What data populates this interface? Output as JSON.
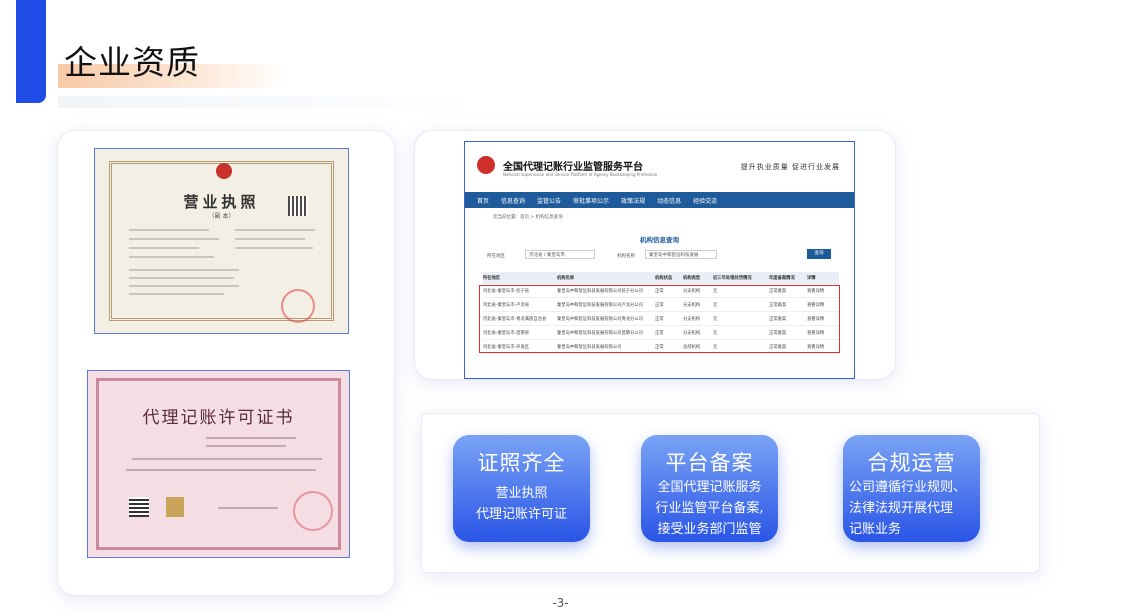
{
  "header": {
    "title": "企业资质"
  },
  "license": {
    "title": "营业执照",
    "subtitle": "（副  本）"
  },
  "permit": {
    "title": "代理记账许可证书"
  },
  "website": {
    "title": "全国代理记账行业监管服务平台",
    "subtitle": "National Supervision and Service Platform of Agency Bookkeeping Profession",
    "slogan": "提升执业质量   促进行业发展",
    "nav": [
      "首页",
      "信息查询",
      "监管公告",
      "审批事项公示",
      "政策法规",
      "动态信息",
      "经验交流"
    ],
    "breadcrumb": "您当前位置：首页 > 机构信息查询",
    "heading": "机构信息查询",
    "form": {
      "region_label": "所在地区",
      "region_value": "河北省 / 秦皇岛市",
      "name_label": "机构名称",
      "name_value": "秦皇岛中和智远科技发展",
      "search_button": "查询"
    },
    "table": {
      "headers": [
        "所在地区",
        "机构名称",
        "机构状态",
        "机构类型",
        "近三年处理处罚情况",
        "年度备案情况",
        "详情"
      ],
      "rows": [
        [
          "河北省-秦皇岛市-抚宁县",
          "秦皇岛中和智远科技发展有限公司抚宁分公司",
          "正常",
          "分支机构",
          "无",
          "正常备案",
          "查看详情"
        ],
        [
          "河北省-秦皇岛市-卢龙县",
          "秦皇岛中和智远科技发展有限公司卢龙分公司",
          "正常",
          "分支机构",
          "无",
          "正常备案",
          "查看详情"
        ],
        [
          "河北省-秦皇岛市-青龙满族自治县",
          "秦皇岛中和智远科技发展有限公司青龙分公司",
          "正常",
          "分支机构",
          "无",
          "正常备案",
          "查看详情"
        ],
        [
          "河北省-秦皇岛市-昌黎县",
          "秦皇岛中和智远科技发展有限公司昌黎分公司",
          "正常",
          "分支机构",
          "无",
          "正常备案",
          "查看详情"
        ],
        [
          "河北省-秦皇岛市-开发区",
          "秦皇岛中和智远科技发展有限公司",
          "正常",
          "总部机构",
          "无",
          "正常备案",
          "查看详情"
        ]
      ]
    }
  },
  "features": [
    {
      "title": "证照齐全",
      "desc": "营业执照\n代理记账许可证"
    },
    {
      "title": "平台备案",
      "desc": "全国代理记账服务\n行业监管平台备案,\n接受业务部门监管"
    },
    {
      "title": "合规运营",
      "desc": "公司遵循行业规则、\n法律法规开展代理\n记账业务"
    }
  ],
  "footer": {
    "page_number": "-3-"
  },
  "colors": {
    "accent": "#1f4be6",
    "nav": "#1e5b9b",
    "highlight": "#e03030"
  }
}
